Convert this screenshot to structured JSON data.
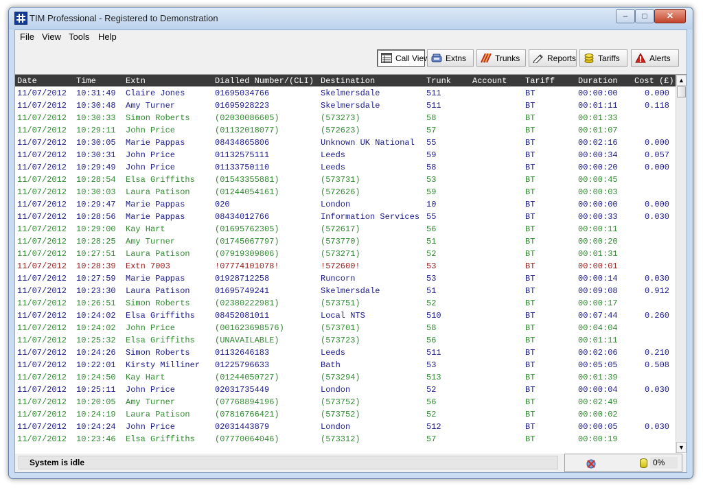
{
  "window": {
    "title": "TIM Professional - Registered to Demonstration"
  },
  "menu": [
    "File",
    "View",
    "Tools",
    "Help"
  ],
  "toolbar": [
    {
      "label": "Call View",
      "icon": "call-view-icon",
      "active": true
    },
    {
      "label": "Extns",
      "icon": "extensions-icon",
      "active": false
    },
    {
      "label": "Trunks",
      "icon": "trunks-icon",
      "active": false
    },
    {
      "label": "Reports",
      "icon": "reports-icon",
      "active": false
    },
    {
      "label": "Tariffs",
      "icon": "tariffs-icon",
      "active": false
    },
    {
      "label": "Alerts",
      "icon": "alerts-icon",
      "active": false
    }
  ],
  "columns": [
    "Date",
    "Time",
    "Extn",
    "Dialled Number/(CLI)",
    "Destination",
    "Trunk",
    "Account",
    "Tariff",
    "Duration",
    "Cost (£)"
  ],
  "colors": {
    "outgoing": "#1b1b8a",
    "incoming": "#2f8a2f",
    "unanswered": "#9a1b1b"
  },
  "rows": [
    [
      "11/07/2012",
      "10:31:49",
      "Claire Jones",
      "01695034766",
      "Skelmersdale",
      "511",
      "",
      "BT",
      "00:00:00",
      "0.000",
      "out"
    ],
    [
      "11/07/2012",
      "10:30:48",
      "Amy Turner",
      "01695928223",
      "Skelmersdale",
      "511",
      "",
      "BT",
      "00:01:11",
      "0.118",
      "out"
    ],
    [
      "11/07/2012",
      "10:30:33",
      "Simon Roberts",
      "(02030086605)",
      "(573273)",
      "58",
      "",
      "BT",
      "00:01:33",
      "",
      "in"
    ],
    [
      "11/07/2012",
      "10:29:11",
      "John Price",
      "(01132018077)",
      "(572623)",
      "57",
      "",
      "BT",
      "00:01:07",
      "",
      "in"
    ],
    [
      "11/07/2012",
      "10:30:05",
      "Marie Pappas",
      "08434865806",
      "Unknown UK National",
      "55",
      "",
      "BT",
      "00:02:16",
      "0.000",
      "out"
    ],
    [
      "11/07/2012",
      "10:30:31",
      "John Price",
      "01132575111",
      "Leeds",
      "59",
      "",
      "BT",
      "00:00:34",
      "0.057",
      "out"
    ],
    [
      "11/07/2012",
      "10:29:49",
      "John Price",
      "01133750110",
      "Leeds",
      "58",
      "",
      "BT",
      "00:00:20",
      "0.000",
      "out"
    ],
    [
      "11/07/2012",
      "10:28:54",
      "Elsa Griffiths",
      "(01543355881)",
      "(573731)",
      "53",
      "",
      "BT",
      "00:00:45",
      "",
      "in"
    ],
    [
      "11/07/2012",
      "10:30:03",
      "Laura Patison",
      "(01244054161)",
      "(572626)",
      "59",
      "",
      "BT",
      "00:00:03",
      "",
      "in"
    ],
    [
      "11/07/2012",
      "10:29:47",
      "Marie Pappas",
      "020",
      "London",
      "10",
      "",
      "BT",
      "00:00:00",
      "0.000",
      "out"
    ],
    [
      "11/07/2012",
      "10:28:56",
      "Marie Pappas",
      "08434012766",
      "Information Services",
      "55",
      "",
      "BT",
      "00:00:33",
      "0.030",
      "out"
    ],
    [
      "11/07/2012",
      "10:29:00",
      "Kay Hart",
      "(01695762305)",
      "(572617)",
      "56",
      "",
      "BT",
      "00:00:11",
      "",
      "in"
    ],
    [
      "11/07/2012",
      "10:28:25",
      "Amy Turner",
      "(01745067797)",
      "(573770)",
      "51",
      "",
      "BT",
      "00:00:20",
      "",
      "in"
    ],
    [
      "11/07/2012",
      "10:27:51",
      "Laura Patison",
      "(07919309806)",
      "(573271)",
      "52",
      "",
      "BT",
      "00:01:31",
      "",
      "in"
    ],
    [
      "11/07/2012",
      "10:28:39",
      "Extn 7003",
      "!07774101078!",
      "!572600!",
      "53",
      "",
      "BT",
      "00:00:01",
      "",
      "missed"
    ],
    [
      "11/07/2012",
      "10:27:59",
      "Marie Pappas",
      "01928712258",
      "Runcorn",
      "53",
      "",
      "BT",
      "00:00:14",
      "0.030",
      "out"
    ],
    [
      "11/07/2012",
      "10:23:30",
      "Laura Patison",
      "01695749241",
      "Skelmersdale",
      "51",
      "",
      "BT",
      "00:09:08",
      "0.912",
      "out"
    ],
    [
      "11/07/2012",
      "10:26:51",
      "Simon Roberts",
      "(02380222981)",
      "(573751)",
      "52",
      "",
      "BT",
      "00:00:17",
      "",
      "in"
    ],
    [
      "11/07/2012",
      "10:24:02",
      "Elsa Griffiths",
      "08452081011",
      "Local NTS",
      "510",
      "",
      "BT",
      "00:07:44",
      "0.260",
      "out"
    ],
    [
      "11/07/2012",
      "10:24:02",
      "John Price",
      "(001623698576)",
      "(573701)",
      "58",
      "",
      "BT",
      "00:04:04",
      "",
      "in"
    ],
    [
      "11/07/2012",
      "10:25:32",
      "Elsa Griffiths",
      "(UNAVAILABLE)",
      "(573723)",
      "56",
      "",
      "BT",
      "00:01:11",
      "",
      "in"
    ],
    [
      "11/07/2012",
      "10:24:26",
      "Simon Roberts",
      "01132646183",
      "Leeds",
      "511",
      "",
      "BT",
      "00:02:06",
      "0.210",
      "out"
    ],
    [
      "11/07/2012",
      "10:22:01",
      "Kirsty Milliner",
      "01225796633",
      "Bath",
      "53",
      "",
      "BT",
      "00:05:05",
      "0.508",
      "out"
    ],
    [
      "11/07/2012",
      "10:24:50",
      "Kay Hart",
      "(01244050727)",
      "(573294)",
      "513",
      "",
      "BT",
      "00:01:39",
      "",
      "in"
    ],
    [
      "11/07/2012",
      "10:25:11",
      "John Price",
      "02031735449",
      "London",
      "52",
      "",
      "BT",
      "00:00:04",
      "0.030",
      "out"
    ],
    [
      "11/07/2012",
      "10:20:05",
      "Amy Turner",
      "(07768894196)",
      "(573752)",
      "56",
      "",
      "BT",
      "00:02:49",
      "",
      "in"
    ],
    [
      "11/07/2012",
      "10:24:19",
      "Laura Patison",
      "(07816766421)",
      "(573752)",
      "52",
      "",
      "BT",
      "00:00:02",
      "",
      "in"
    ],
    [
      "11/07/2012",
      "10:24:24",
      "John Price",
      "02031443879",
      "London",
      "512",
      "",
      "BT",
      "00:00:05",
      "0.030",
      "out"
    ],
    [
      "11/07/2012",
      "10:23:46",
      "Elsa Griffiths",
      "(07770064046)",
      "(573312)",
      "57",
      "",
      "BT",
      "00:00:19",
      "",
      "in"
    ]
  ],
  "status": {
    "text": "System is idle",
    "percent": "0%",
    "icons": [
      "disconnected-icon",
      "database-icon"
    ]
  }
}
